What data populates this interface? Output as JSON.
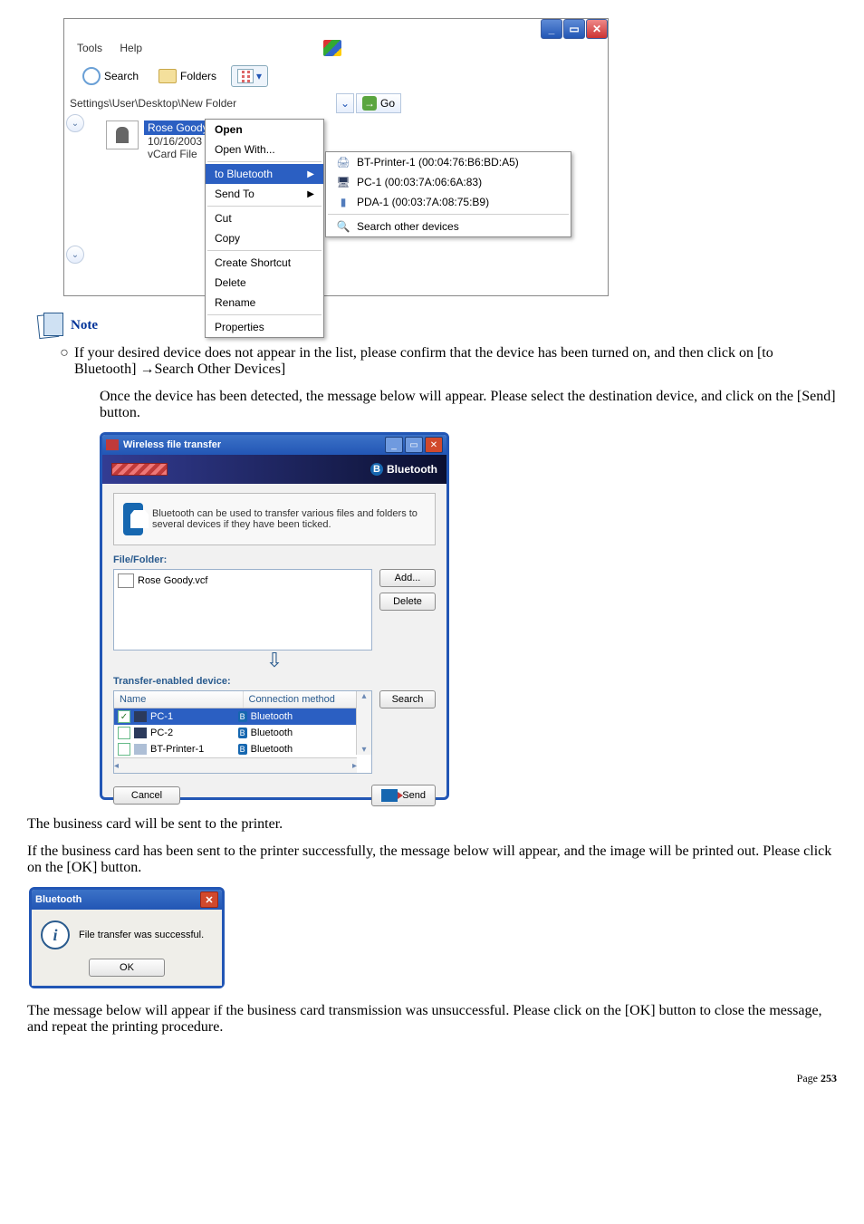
{
  "explorer": {
    "menu": {
      "tools": "Tools",
      "help": "Help"
    },
    "toolbar": {
      "search": "Search",
      "folders": "Folders"
    },
    "address": "Settings\\User\\Desktop\\New Folder",
    "go": "Go",
    "file": {
      "name": "Rose Goody.vcf",
      "date": "10/16/2003",
      "type": "vCard File"
    },
    "context": {
      "open": "Open",
      "open_with": "Open With...",
      "to_bluetooth": "to Bluetooth",
      "send_to": "Send To",
      "cut": "Cut",
      "copy": "Copy",
      "create_shortcut": "Create Shortcut",
      "delete": "Delete",
      "rename": "Rename",
      "properties": "Properties"
    },
    "submenu": {
      "item1": "BT-Printer-1 (00:04:76:B6:BD:A5)",
      "item2": "PC-1 (00:03:7A:06:6A:83)",
      "item3": "PDA-1 (00:03:7A:08:75:B9)",
      "item4": "Search other devices"
    }
  },
  "note": {
    "label": "Note"
  },
  "note_text": "If your desired device does not appear in the list, please confirm that the device has been turned on, and then click on [to Bluetooth] →Search Other Devices]",
  "para_after_note": "Once the device has been detected, the message below will appear. Please select the destination device, and click on the [Send] button.",
  "wft": {
    "title": "Wireless file transfer",
    "brand": "Bluetooth",
    "info_text": "Bluetooth can be used to transfer various files and folders to several devices if they have been ticked.",
    "file_folder_label": "File/Folder:",
    "file_entry": "Rose Goody.vcf",
    "add_btn": "Add...",
    "delete_btn": "Delete",
    "transfer_label": "Transfer-enabled device:",
    "col_name": "Name",
    "col_conn": "Connection method",
    "rows": {
      "r1_name": "PC-1",
      "r1_conn": "Bluetooth",
      "r2_name": "PC-2",
      "r2_conn": "Bluetooth",
      "r3_name": "BT-Printer-1",
      "r3_conn": "Bluetooth"
    },
    "search_btn": "Search",
    "cancel_btn": "Cancel",
    "send_btn": "Send"
  },
  "para_printer": "The business card will be sent to the printer.",
  "para_success": "If the business card has been sent to the printer successfully, the message below will appear, and the image will be printed out. Please click on the [OK] button.",
  "msgbox": {
    "title": "Bluetooth",
    "text": "File transfer was successful.",
    "ok": "OK"
  },
  "para_fail": "The message below will appear if the business card transmission was unsuccessful. Please click on the [OK] button to close the message, and repeat the printing procedure.",
  "footer": {
    "page_label": "Page ",
    "page_num": "253"
  }
}
